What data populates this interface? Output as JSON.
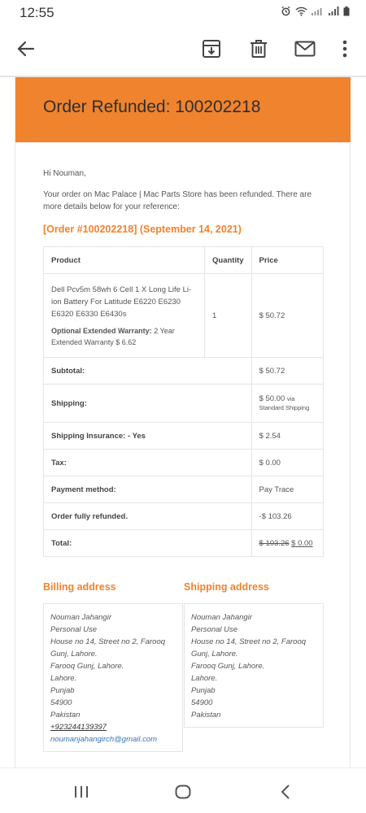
{
  "status_bar": {
    "time": "12:55"
  },
  "toolbar": {
    "back_icon": "arrow-left-icon",
    "archive_icon": "archive-icon",
    "delete_icon": "trash-icon",
    "mail_icon": "mail-icon",
    "more_icon": "more-vert-icon"
  },
  "email": {
    "banner_title": "Order Refunded: 100202218",
    "banner_color": "#f0832d",
    "greeting": "Hi Nouman,",
    "intro": "Your order on Mac Palace | Mac Parts Store has been refunded. There are more details below for your reference:",
    "order_heading": "[Order #100202218] (September 14, 2021)",
    "table": {
      "headers": [
        "Product",
        "Quantity",
        "Price"
      ],
      "item": {
        "name": "Dell Pcv5m 58wh 6 Cell 1 X Long Life Li-ion Battery For Latitude E6220 E6230 E6320 E6330 E6430s",
        "warranty_label": "Optional Extended Warranty:",
        "warranty_value": "2 Year Extended Warranty $ 6.62",
        "quantity": "1",
        "price": "$ 50.72"
      },
      "totals": {
        "subtotal_label": "Subtotal:",
        "subtotal_value": "$ 50.72",
        "shipping_label": "Shipping:",
        "shipping_value": "$ 50.00",
        "shipping_via": "via Standard Shipping",
        "insurance_label": "Shipping Insurance: - Yes",
        "insurance_value": "$ 2.54",
        "tax_label": "Tax:",
        "tax_value": "$ 0.00",
        "payment_label": "Payment method:",
        "payment_value": "Pay Trace",
        "refunded_label": "Order fully refunded.",
        "refunded_value": "-$ 103.26",
        "total_label": "Total:",
        "total_old": "$ 103.26",
        "total_new": "$ 0.00"
      }
    },
    "billing": {
      "heading": "Billing address",
      "name": "Nouman Jahangir",
      "company": "Personal Use",
      "line1": "House no 14, Street no 2, Farooq",
      "line2": "Gunj, Lahore.",
      "line3": "Farooq Gunj, Lahore.",
      "city": "Lahore.",
      "state": "Punjab",
      "postcode": "54900",
      "country": "Pakistan",
      "phone": "+923244139397",
      "email": "noumanjahangirch@gmail.com"
    },
    "shipping": {
      "heading": "Shipping address",
      "name": "Nouman Jahangir",
      "company": "Personal Use",
      "line1": "House no 14, Street no 2, Farooq",
      "line2": "Gunj, Lahore.",
      "line3": "Farooq Gunj, Lahore.",
      "city": "Lahore.",
      "state": "Punjab",
      "postcode": "54900",
      "country": "Pakistan"
    }
  },
  "nav_bar": {
    "recents_icon": "recents-icon",
    "home_icon": "home-icon",
    "back_icon": "back-chevron-icon"
  }
}
